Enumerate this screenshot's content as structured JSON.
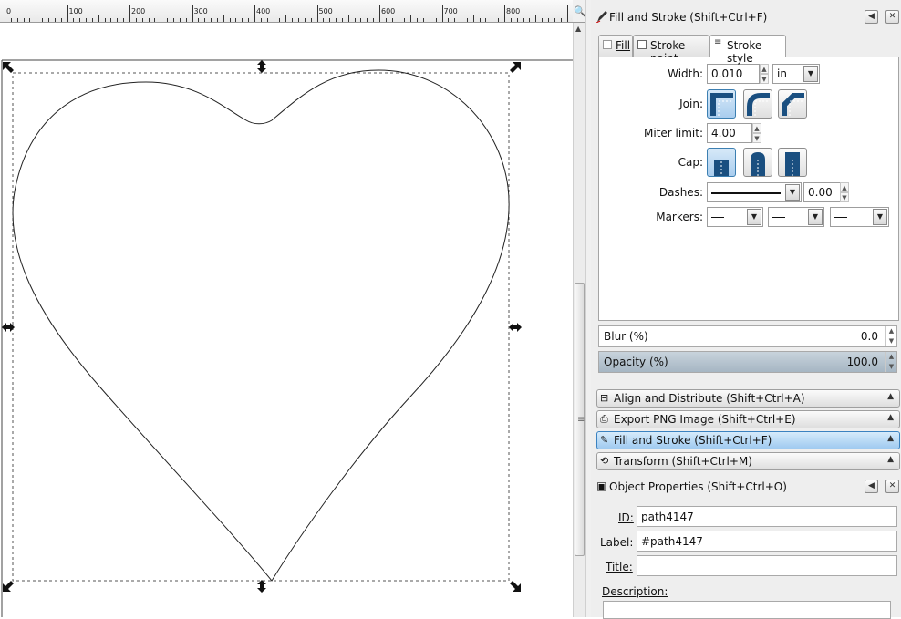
{
  "ruler": {
    "labels": [
      "0",
      "100",
      "200",
      "300",
      "400",
      "500",
      "600",
      "700",
      "800"
    ]
  },
  "dock": {
    "fill_stroke_dialog": {
      "title": "Fill and Stroke (Shift+Ctrl+F)",
      "tabs": [
        {
          "label": "Fill",
          "active": false
        },
        {
          "label": "Stroke paint",
          "active": false
        },
        {
          "label": "Stroke style",
          "active": true
        }
      ],
      "stroke_style": {
        "width_label": "Width:",
        "width_value": "0.010",
        "unit_value": "in",
        "join_label": "Join:",
        "miter_label": "Miter limit:",
        "miter_value": "4.00",
        "cap_label": "Cap:",
        "dashes_label": "Dashes:",
        "dash_offset": "0.00",
        "markers_label": "Markers:"
      },
      "blur": {
        "label": "Blur (%)",
        "value": "0.0"
      },
      "opacity": {
        "label": "Opacity (%)",
        "value": "100.0",
        "fraction": 1.0
      }
    },
    "collapsed_panels": [
      {
        "label": "Align and Distribute (Shift+Ctrl+A)",
        "icon": "align-icon",
        "active": false
      },
      {
        "label": "Export PNG Image (Shift+Ctrl+E)",
        "icon": "export-icon",
        "active": false
      },
      {
        "label": "Fill and Stroke (Shift+Ctrl+F)",
        "icon": "fill-stroke-icon",
        "active": true
      },
      {
        "label": "Transform (Shift+Ctrl+M)",
        "icon": "transform-icon",
        "active": false
      }
    ],
    "object_properties": {
      "title": "Object Properties (Shift+Ctrl+O)",
      "id_label": "ID:",
      "id_value": "path4147",
      "label_label": "Label:",
      "label_value": "#path4147",
      "title_label": "Title:",
      "title_value": "",
      "description_label": "Description:"
    }
  }
}
